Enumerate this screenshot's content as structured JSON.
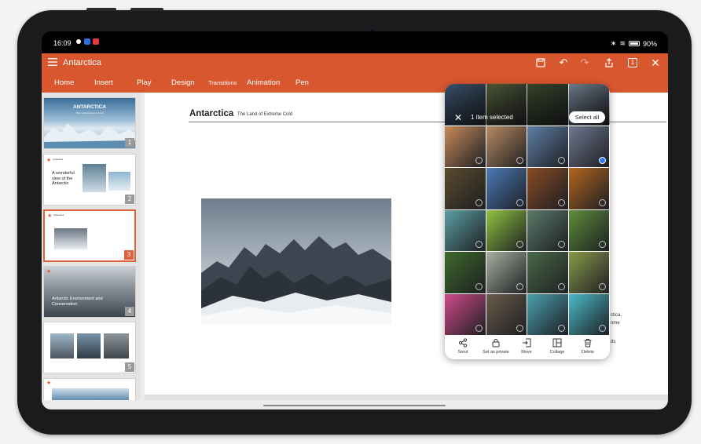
{
  "status_bar": {
    "time": "16:09",
    "battery": "90%"
  },
  "app": {
    "title": "Antarctica",
    "tabs": [
      "Home",
      "Insert",
      "Play",
      "Design",
      "Transitions",
      "Animation",
      "Pen"
    ],
    "page_count_badge": "1"
  },
  "thumbnails": [
    {
      "num": "1",
      "title": "ANTARCTICA",
      "subtitle": "The Land of Extreme Cold"
    },
    {
      "num": "2",
      "heading": "A wonderful view of the Antarctic",
      "mini_title": "Antarctica"
    },
    {
      "num": "3",
      "mini_title": "Antarctica"
    },
    {
      "num": "4",
      "heading": "Antarctic Environment and Conservation"
    },
    {
      "num": "5"
    },
    {
      "num": "6"
    }
  ],
  "slide": {
    "title": "Antarctica",
    "subtitle": "The Land of Extreme Cold",
    "peek_text_1": "ctica,",
    "peek_text_2": "ome",
    "peek_text_3": "ds"
  },
  "gallery": {
    "selected_text": "1 item selected",
    "select_all": "Select all",
    "actions": [
      {
        "label": "Send",
        "icon": "share-icon"
      },
      {
        "label": "Set as private",
        "icon": "lock-icon"
      },
      {
        "label": "Move",
        "icon": "move-icon"
      },
      {
        "label": "Collage",
        "icon": "collage-icon"
      },
      {
        "label": "Delete",
        "icon": "trash-icon"
      }
    ],
    "tile_colors": [
      "#3f5a78",
      "#55603a",
      "#3c4a2c",
      "#7b8a9c",
      "#c88a5a",
      "#b98a62",
      "#5f7fa8",
      "#6e7890",
      "#5a4a2c",
      "#4b79b8",
      "#8a4a22",
      "#b4661e",
      "#5d9fa4",
      "#8fc440",
      "#5a7a6a",
      "#5e8e3a",
      "#3e6a2c",
      "#a8b0a0",
      "#4a6a48",
      "#8a9a4a",
      "#d04a8a",
      "#6a5a4a",
      "#4aa0b0",
      "#4abac8"
    ]
  }
}
